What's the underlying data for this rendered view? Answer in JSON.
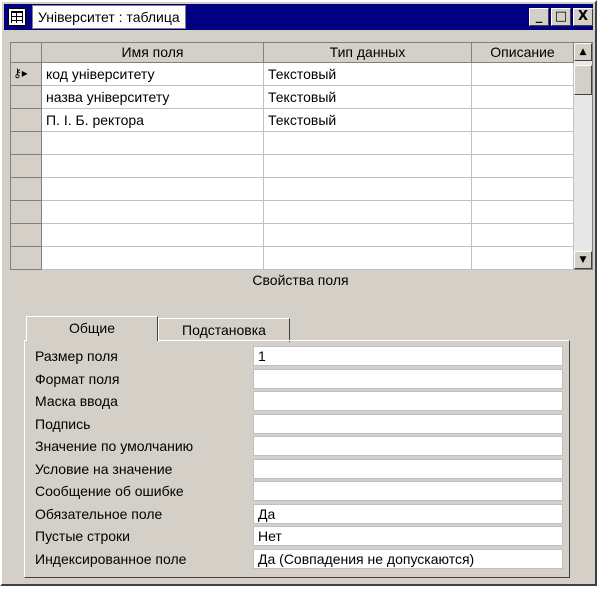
{
  "window": {
    "title": "Університет : таблица",
    "minimize_label": "_",
    "maximize_label": "□",
    "close_label": "X"
  },
  "grid": {
    "columns": [
      "Имя поля",
      "Тип данных",
      "Описание"
    ],
    "rows": [
      {
        "name": "код університету",
        "type": "Текстовый",
        "description": "",
        "primary_key": true
      },
      {
        "name": "назва університету",
        "type": "Текстовый",
        "description": ""
      },
      {
        "name": "П. І. Б. ректора",
        "type": "Текстовый",
        "description": ""
      },
      {
        "name": "",
        "type": "",
        "description": ""
      },
      {
        "name": "",
        "type": "",
        "description": ""
      },
      {
        "name": "",
        "type": "",
        "description": ""
      },
      {
        "name": "",
        "type": "",
        "description": ""
      },
      {
        "name": "",
        "type": "",
        "description": ""
      },
      {
        "name": "",
        "type": "",
        "description": ""
      }
    ]
  },
  "properties": {
    "title": "Свойства поля",
    "tabs": [
      "Общие",
      "Подстановка"
    ],
    "active_tab": "Общие",
    "fields": [
      {
        "label": "Размер поля",
        "value": "1"
      },
      {
        "label": "Формат поля",
        "value": ""
      },
      {
        "label": "Маска ввода",
        "value": ""
      },
      {
        "label": "Подпись",
        "value": ""
      },
      {
        "label": "Значение по умолчанию",
        "value": ""
      },
      {
        "label": "Условие на значение",
        "value": ""
      },
      {
        "label": "Сообщение об ошибке",
        "value": ""
      },
      {
        "label": "Обязательное поле",
        "value": "Да"
      },
      {
        "label": "Пустые строки",
        "value": "Нет"
      },
      {
        "label": "Индексированное поле",
        "value": "Да (Совпадения не допускаются)"
      }
    ]
  },
  "colors": {
    "titlebar": "#000080",
    "face": "#d4d0c8"
  }
}
